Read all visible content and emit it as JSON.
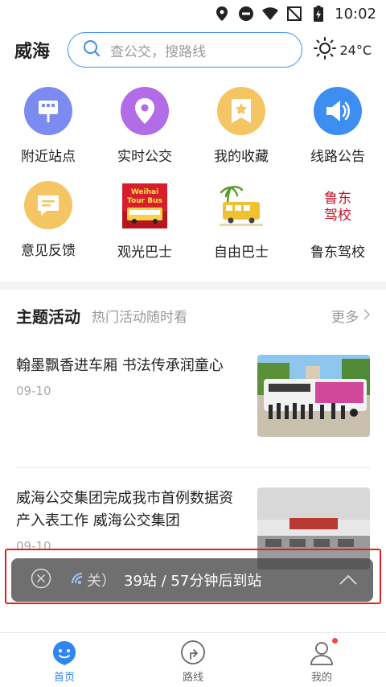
{
  "status": {
    "time": "10:02"
  },
  "header": {
    "city": "威海",
    "search_placeholder": "查公交，搜路线",
    "temperature": "24°C"
  },
  "quick_menu": [
    {
      "label": "附近站点",
      "icon": "bus-stop-icon",
      "color": "#7b8bef"
    },
    {
      "label": "实时公交",
      "icon": "location-pin-icon",
      "color": "#b26ce6"
    },
    {
      "label": "我的收藏",
      "icon": "star-bookmark-icon",
      "color": "#f6c563"
    },
    {
      "label": "线路公告",
      "icon": "speaker-icon",
      "color": "#3d8ef0"
    },
    {
      "label": "意见反馈",
      "icon": "feedback-icon",
      "color": "#f6c563"
    },
    {
      "label": "观光巴士",
      "icon": "tour-bus-icon",
      "badge_text": "Weihai Tour Bus"
    },
    {
      "label": "自由巴士",
      "icon": "free-bus-icon"
    },
    {
      "label": "鲁东驾校",
      "icon": "ludong-driving-school-icon",
      "badge_text": "鲁东驾校"
    }
  ],
  "section": {
    "title": "主题活动",
    "subtitle": "热门活动随时看",
    "more_label": "更多"
  },
  "news": [
    {
      "title": "翰墨飘香进车厢 书法传承润童心",
      "date": "09-10"
    },
    {
      "title": "威海公交集团完成我市首例数据资产入表工作 威海公交集团",
      "date": "09-10"
    }
  ],
  "overlay": {
    "message": "39站 / 57分钟后到站",
    "prefix": "关）"
  },
  "bottom_nav": [
    {
      "label": "首页",
      "icon": "home-icon"
    },
    {
      "label": "路线",
      "icon": "route-icon"
    },
    {
      "label": "我的",
      "icon": "profile-icon"
    }
  ],
  "colors": {
    "accent": "#2f86f0",
    "highlight_frame": "#e02020"
  }
}
